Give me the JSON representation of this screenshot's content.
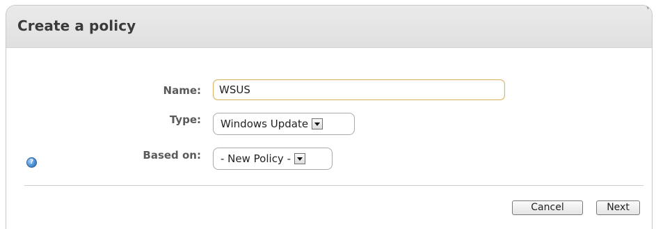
{
  "dialog": {
    "title": "Create a policy"
  },
  "form": {
    "name": {
      "label": "Name:",
      "value": "WSUS"
    },
    "type": {
      "label": "Type:",
      "selected": "Windows Update"
    },
    "based_on": {
      "label": "Based on:",
      "selected": "- New Policy -"
    }
  },
  "buttons": {
    "cancel": "Cancel",
    "next": "Next"
  },
  "icons": {
    "help": "help-icon"
  },
  "colors": {
    "header_bg": "#e4e4e4",
    "input_focus_border": "#d8b46a",
    "help_icon": "#4d8fd2"
  }
}
